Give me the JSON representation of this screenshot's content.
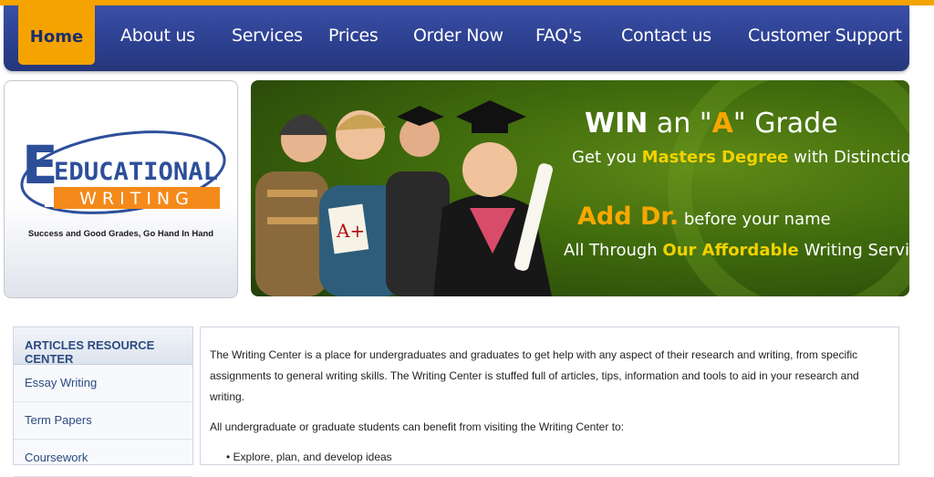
{
  "nav": {
    "home": "Home",
    "about": "About us",
    "services": "Services",
    "prices": "Prices",
    "order": "Order Now",
    "faq": "FAQ's",
    "contact": "Contact us",
    "support": "Customer Support"
  },
  "logo": {
    "word1": "EDUCATIONAL",
    "word2": "WRITING",
    "tagline": "Success and Good Grades, Go Hand In Hand"
  },
  "banner": {
    "line1_a": "WIN",
    "line1_b": " an \"",
    "line1_c": "A",
    "line1_d": "\" Grade",
    "line2_a": "Get you ",
    "line2_b": "Masters Degree",
    "line2_c": " with Distinction",
    "line3_a": "Add Dr.",
    "line3_b": " before your name",
    "line4_a": "All Through ",
    "line4_b": "Our Affordable",
    "line4_c": " Writing Service",
    "paper_grade": "A+"
  },
  "sidebar": {
    "heading": "ARTICLES RESOURCE CENTER",
    "items": [
      {
        "label": "Essay Writing"
      },
      {
        "label": "Term Papers"
      },
      {
        "label": "Coursework"
      }
    ]
  },
  "content": {
    "para1": "The Writing Center is a place for undergraduates and graduates to get help with any aspect of their research and writing, from specific assignments to general writing skills. The Writing Center is stuffed full of articles, tips, information and tools to aid in your research and writing.",
    "para2": "All undergraduate or graduate students can benefit from visiting the Writing Center to:",
    "bullet1": "Explore, plan, and develop ideas"
  },
  "colors": {
    "nav_bg": "#2c3f8f",
    "accent_orange": "#f4a300",
    "banner_green": "#3f6a0c",
    "link_blue": "#2b4a80"
  }
}
